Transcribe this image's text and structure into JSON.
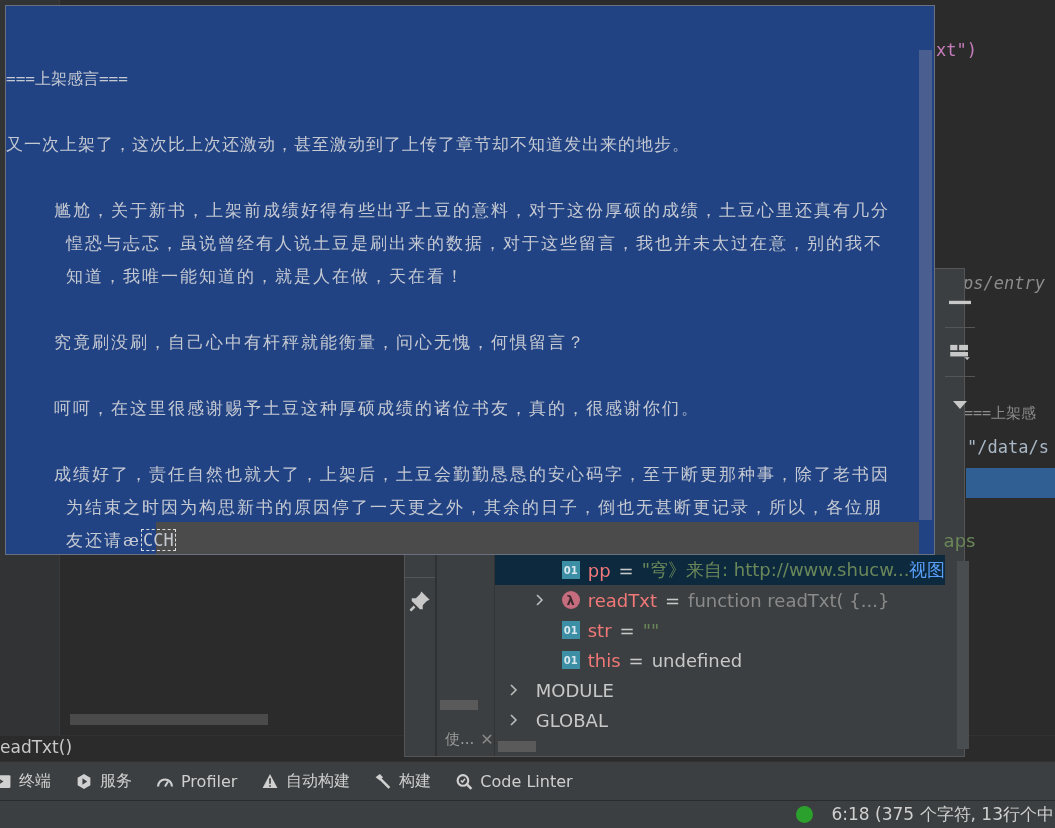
{
  "editor": {
    "lines": [
      {
        "kind": "string",
        "text": "xt\")"
      },
      {
        "kind": "path",
        "text": "ps/entry"
      },
      {
        "kind": "comment",
        "text": "===上架感"
      },
      {
        "kind": "plain",
        "text": "\"/data/s"
      }
    ],
    "current_line": true
  },
  "popup": {
    "paragraphs": [
      {
        "kind": "heading",
        "lines": [
          "===上架感言==="
        ]
      },
      {
        "kind": "plain",
        "lines": [
          "又一次上架了，这次比上次还激动，甚至激动到了上传了章节却不知道发出来的地步。"
        ]
      },
      {
        "kind": "indented",
        "lines": [
          "尴尬，关于新书，上架前成绩好得有些出乎土豆的意料，对于这份厚硕的成绩，土豆心里还真有几分",
          "惶恐与忐忑，虽说曾经有人说土豆是刷出来的数据，对于这些留言，我也并未太过在意，别的我不",
          "知道，我唯一能知道的，就是人在做，天在看！"
        ]
      },
      {
        "kind": "indented",
        "lines": [
          "究竟刷没刷，自己心中有杆秤就能衡量，问心无愧，何惧留言？"
        ]
      },
      {
        "kind": "indented",
        "lines": [
          "呵呵，在这里很感谢赐予土豆这种厚硕成绩的诸位书友，真的，很感谢你们。"
        ]
      },
      {
        "kind": "indented",
        "lines": [
          "成绩好了，责任自然也就大了，上架后，土豆会勤勤恳恳的安心码字，至于断更那种事，除了老书因",
          "为结束之时因为构思新书的原因停了一天更之外，其余的日子，倒也无甚断更记录，所以，各位朋",
          "友还请æ"
        ]
      }
    ],
    "boxed_tail": "CCH"
  },
  "debugger": {
    "tab_label": "使...",
    "tab_close": "✕",
    "variables": [
      {
        "kind": "hidden",
        "value": "aps",
        "selected": false
      },
      {
        "kind": "string",
        "badge": "01",
        "name": "pp",
        "equals": "=",
        "value": "\"穹》来自: http://www.shucw...",
        "link": "视图",
        "selected": true,
        "expandable": false
      },
      {
        "kind": "function",
        "badge": "λ",
        "name": "readTxt",
        "equals": "=",
        "value": "function readTxt( {...}",
        "selected": false,
        "expandable": true
      },
      {
        "kind": "string",
        "badge": "01",
        "name": "str",
        "equals": "=",
        "value": "\"\"",
        "selected": false,
        "expandable": false
      },
      {
        "kind": "value",
        "badge": "01",
        "name": "this",
        "equals": "=",
        "value": "undefined",
        "selected": false,
        "expandable": false
      }
    ],
    "scopes": [
      "MODULE",
      "GLOBAL"
    ]
  },
  "breadcrumb": "eadTxt()",
  "tool_windows": [
    {
      "kind": "terminal",
      "label": "终端"
    },
    {
      "kind": "services",
      "label": "服务"
    },
    {
      "kind": "profiler",
      "label": "Profiler"
    },
    {
      "kind": "warning",
      "label": "自动构建"
    },
    {
      "kind": "build",
      "label": "构建"
    },
    {
      "kind": "linter",
      "label": "Code Linter"
    }
  ],
  "status": {
    "text": "6:18 (375 个字符, 13行个中",
    "ok": true
  }
}
